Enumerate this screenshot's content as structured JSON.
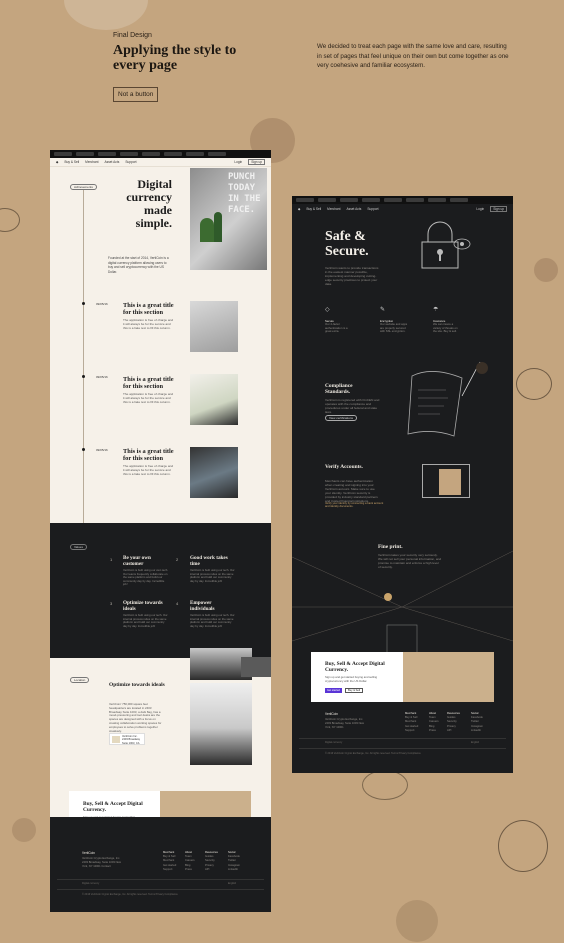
{
  "intro": {
    "eyebrow": "Final Design",
    "headline": "Applying the style to every page",
    "button": "Not a button",
    "description": "We decided to treat each page with the same love and care, resulting in set of pages that feel unique on their own but come together as one very coehesive and familiar ecosystem."
  },
  "light_page": {
    "nav_items": [
      "Buy & Sell",
      "Merchant",
      "Asset Acts",
      "Support"
    ],
    "nav_login": "Login",
    "nav_signup": "Sign up",
    "tag_history": "Achievements",
    "hero_title": "Digital currency made simple.",
    "hero_body": "Founded at the start of 2014, VertiCoin is a digital currency platform allowing users to buy and sell cryptocurrency with the US Dollar.",
    "punch_lines": [
      "PUNCH",
      "TODAY",
      "IN THE",
      "FACE."
    ],
    "sections": [
      {
        "date": "09/05/16",
        "title": "This is a great title for this section",
        "body": "The application is free of charge and it will always be for the service and this is a fake text to fill this column."
      },
      {
        "date": "09/05/16",
        "title": "This is a great title for this section",
        "body": "The application is free of charge and it will always be for the service and this is a fake text to fill this column."
      },
      {
        "date": "09/05/16",
        "title": "This is a great title for this section",
        "body": "The application is free of charge and it will always be for the service and this is a fake text to fill this column."
      }
    ],
    "tag_values": "Values",
    "values": [
      {
        "num": "1",
        "title": "Be your own customer",
        "body": "VertiCoin is built using our own tech. Our teams frequently collaborate on the same platform and build our community day by day. Incredible job!"
      },
      {
        "num": "2",
        "title": "Good work takes time",
        "body": "VertiCoin is built using our tech. Our internal process relies on the same platform and build our community day by day. Incredible job!"
      },
      {
        "num": "3",
        "title": "Optimize towards ideals",
        "body": "VertiCoin is built using our tech. Our internal process relies on the same platform and build our community day by day. Incredible job!"
      },
      {
        "num": "4",
        "title": "Empower individuals",
        "body": "VertiCoin is built using our tech. Our internal process relies on the same platform and build our community day by day. Incredible job!"
      }
    ],
    "tag_location": "Location",
    "loc_title": "Optimize towards ideals",
    "loc_body": "VertiCoin' 750,000 square feet headquarters are located in 2403 Broadway Suite 1003, a dark 8ag, has a mood-pressuring and tool desks are the spaces are designed with a focus on creating collaboration working spaces for employees to solve problems together creatively.",
    "loc_card": "VertiCoin Inc. 2403 Broadway Suite 1003, CA",
    "cta_title": "Buy, Sell & Accept Digital Currency.",
    "cta_body": "Sign up and get started buying and selling cryptocurrency with the US Dollar.",
    "cta_primary": "Get started",
    "cta_secondary": "Buy & Sell",
    "footer": {
      "logo": "VertiCoin",
      "address": "VertiCoin Crypto Exchange, Inc. 2403 Broadway, Suite 1003 New York, NY 10001 Contact",
      "cols": [
        {
          "head": "Merchant",
          "items": [
            "Buy & Sell",
            "Merchant",
            "Get started",
            "Support"
          ]
        },
        {
          "head": "About",
          "items": [
            "Team",
            "Careers",
            "Blog",
            "Press"
          ]
        },
        {
          "head": "Resources",
          "items": [
            "Guides",
            "Security",
            "Privacy",
            "API"
          ]
        },
        {
          "head": "Social",
          "items": [
            "Facebook",
            "Twitter",
            "Instagram",
            "LinkedIn"
          ]
        }
      ],
      "digital": "Digital currency",
      "lang": "English",
      "legal": "© 2016 VertiCoin Crypto Exchange, Inc. All rights reserved. Terms Privacy Compliance"
    }
  },
  "dark_page": {
    "nav_items": [
      "Buy & Sell",
      "Merchant",
      "Asset Acts",
      "Support"
    ],
    "nav_login": "Login",
    "nav_signup": "Sign up",
    "hero_title": "Safe & Secure.",
    "hero_body": "VertiCoin wants to provide transactions in the easiest manner possible, implementing and developing cutting-edge security practices to protect your data.",
    "features": [
      {
        "title": "Secure",
        "body": "Our 2-factor authentication is a great extra."
      },
      {
        "title": "Encryption",
        "body": "Our website and apps are properly secured with SSL encryption."
      },
      {
        "title": "Insurance",
        "body": "We can insure a variety of threats on the site. Buy & sell."
      }
    ],
    "compliance_title": "Compliance Standards.",
    "compliance_body": "VertiCoin is registered with FinCEN and operates with the compliance and procedures under all federal and state laws.",
    "compliance_button": "View certifications",
    "verify_title": "Verify Accounts.",
    "verify_body": "Merchants can have authentication when creating and signing into your VertiCoin account. Make sure to use your identity. VertiCoin security is provided by industry standard partners and trusted financial institutions.",
    "verify_link": "Verify your identity by connecting a bank account and identity documents.",
    "fine_title": "Fine print.",
    "fine_body": "VertiCoin takes your security very seriously. We will not sell your personal information, and promise to maintain and enforce a high level of security.",
    "cta_title": "Buy, Sell & Accept Digital Currency.",
    "cta_body": "Sign up and get started buying and selling cryptocurrency with the US Dollar.",
    "cta_primary": "Get started",
    "cta_secondary": "Buy & Sell",
    "footer": {
      "logo": "VertiCoin",
      "address": "VertiCoin Crypto Exchange, Inc. 2403 Broadway, Suite 1003 New York, NY 10001",
      "cols": [
        {
          "head": "Merchant",
          "items": [
            "Buy & Sell",
            "Merchant",
            "Get started",
            "Support"
          ]
        },
        {
          "head": "About",
          "items": [
            "Team",
            "Careers",
            "Blog",
            "Press"
          ]
        },
        {
          "head": "Resources",
          "items": [
            "Guides",
            "Security",
            "Privacy",
            "API"
          ]
        },
        {
          "head": "Social",
          "items": [
            "Facebook",
            "Twitter",
            "Instagram",
            "LinkedIn"
          ]
        }
      ],
      "digital": "Digital currency",
      "lang": "English",
      "legal": "© 2016 VertiCoin Crypto Exchange, Inc. All rights reserved. Terms Privacy Compliance"
    }
  },
  "colors": {
    "background": "#c4a57f",
    "light_page": "#f6f1e9",
    "dark_page": "#1b1c1e",
    "accent": "#5a35d6",
    "gold": "#c9a36a"
  }
}
